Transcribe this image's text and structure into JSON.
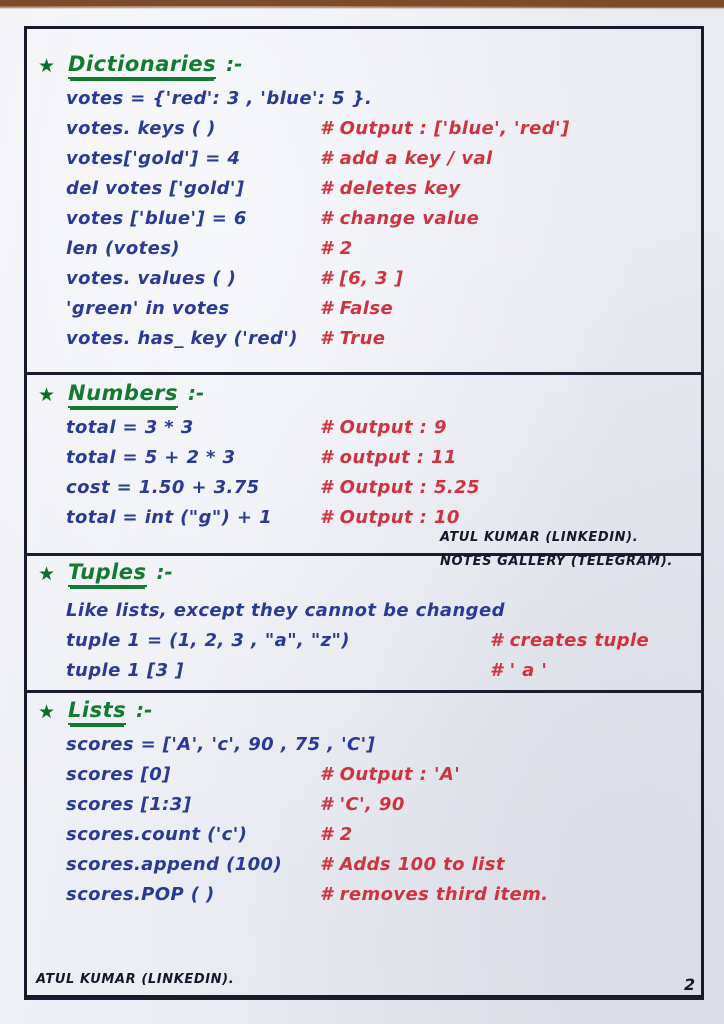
{
  "page": {
    "page_number": "2",
    "bullet_glyph": "★",
    "colors": {
      "ink_blue": "#2a3b96",
      "ink_red": "#cf3340",
      "ink_green": "#157a31",
      "ink_black": "#15172a",
      "paper": "#eceef4",
      "frame": "#181a2b",
      "desk": "#7d4a2a"
    }
  },
  "sections": [
    {
      "title": "Dictionaries",
      "colon": ":-",
      "lines": [
        {
          "code": "votes = {'red': 3  ,  'blue': 5 }.",
          "comment": "",
          "wide": true
        },
        {
          "code": "votes. keys ( )",
          "comment": "# Output : ['blue', 'red']"
        },
        {
          "code": "votes['gold'] = 4",
          "comment": "# add a key / val"
        },
        {
          "code": "del votes ['gold']",
          "comment": "# deletes key"
        },
        {
          "code": "votes ['blue'] = 6",
          "comment": "# change value"
        },
        {
          "code": "len (votes)",
          "comment": "#  2"
        },
        {
          "code": "votes. values ( )",
          "comment": "# [6, 3 ]"
        },
        {
          "code": "'green' in votes",
          "comment": "# False"
        },
        {
          "code": "votes. has_ key ('red')",
          "comment": "# True"
        }
      ]
    },
    {
      "title": "Numbers",
      "colon": ":-",
      "lines": [
        {
          "code": "total = 3 * 3",
          "comment": "#  Output : 9"
        },
        {
          "code": "total = 5 + 2 * 3",
          "comment": "#  output : 11"
        },
        {
          "code": "cost = 1.50 + 3.75",
          "comment": "#  Output : 5.25"
        },
        {
          "code": "total = int (\"g\") + 1",
          "comment": "# Output : 10"
        }
      ]
    },
    {
      "title": "Tuples",
      "colon": ":-",
      "lines": [
        {
          "code": "Like lists, except they cannot be changed",
          "comment": "",
          "wide": true
        },
        {
          "code": "tuple 1 = (1, 2, 3 , \"a\", \"z\")",
          "comment": "# creates tuple"
        },
        {
          "code": "tuple 1 [3 ]",
          "comment": "# ' a '"
        }
      ]
    },
    {
      "title": "Lists",
      "colon": ":-",
      "lines": [
        {
          "code": "scores = ['A', 'c',  90 ,  75 , 'C']",
          "comment": "",
          "wide": true
        },
        {
          "code": "scores [0]",
          "comment": "# Output : 'A'"
        },
        {
          "code": "scores [1:3]",
          "comment": "# 'C', 90"
        },
        {
          "code": "scores.count ('c')",
          "comment": "#  2"
        },
        {
          "code": "scores.append (100)",
          "comment": "# Adds 100 to list"
        },
        {
          "code": "scores.POP ( )",
          "comment": "# removes third item."
        }
      ]
    }
  ],
  "signature": {
    "line1": "ATUL KUMAR (LINKEDIN).",
    "line2": "NOTES GALLERY (TELEGRAM).",
    "footer": "ATUL KUMAR (LINKEDIN)."
  }
}
